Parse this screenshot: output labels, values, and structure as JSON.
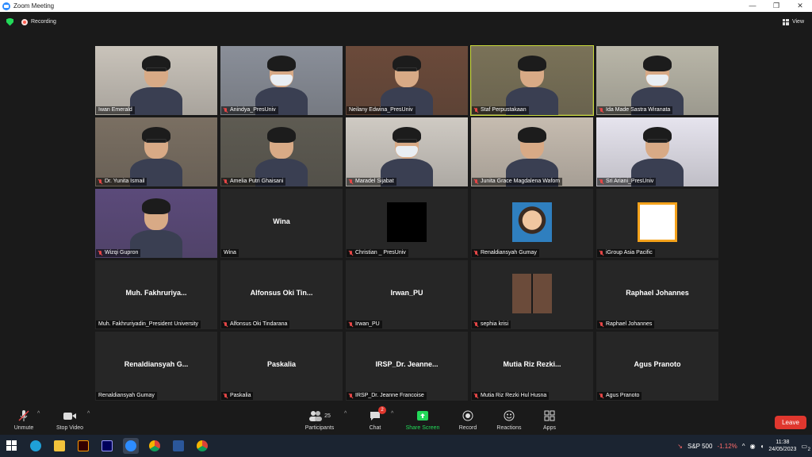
{
  "window": {
    "title": "Zoom Meeting",
    "controls": [
      "—",
      "❐",
      "✕"
    ]
  },
  "meeting_bar": {
    "recording_label": "Recording",
    "view_label": "View"
  },
  "participants": [
    {
      "name": "Iwan Emerald",
      "muted": false,
      "video": true,
      "bg": "#c9c3ba"
    },
    {
      "name": "Anindya_PresUniv",
      "muted": true,
      "video": true,
      "bg": "#8a8f99"
    },
    {
      "name": "Neilany Edwina_PresUniv",
      "muted": false,
      "video": true,
      "bg": "#6b4a3a"
    },
    {
      "name": "Staf Perpustakaan",
      "muted": true,
      "video": true,
      "bg": "#7a7258",
      "active": true
    },
    {
      "name": "Ida Made Sastra Wiranata",
      "muted": true,
      "video": true,
      "bg": "#b9b6a8"
    },
    {
      "name": "Dr. Yunita Ismail",
      "muted": true,
      "video": true,
      "bg": "#7a6f62"
    },
    {
      "name": "Amelia Putri Ghaisani",
      "muted": true,
      "video": true,
      "bg": "#5e5b52"
    },
    {
      "name": "Maradel Sijabat",
      "muted": true,
      "video": true,
      "bg": "#cfcac3"
    },
    {
      "name": "Junita Grace Magdalena Wafom",
      "muted": true,
      "video": true,
      "bg": "#c6bcb0"
    },
    {
      "name": "Sri Ariani_PresUniv",
      "muted": true,
      "video": true,
      "bg": "#e6e4ee"
    },
    {
      "name": "Wizqi Gupron",
      "muted": true,
      "video": true,
      "bg": "#5b4a7a"
    },
    {
      "name": "Wina",
      "muted": false,
      "video": false,
      "display": "Wina"
    },
    {
      "name": "Christian _ PresUniv",
      "muted": true,
      "video": false,
      "avatar": "black"
    },
    {
      "name": "Renaldiansyah Gumay",
      "muted": true,
      "video": false,
      "avatar": "cartoon"
    },
    {
      "name": "iGroup Asia Pacific",
      "muted": true,
      "video": false,
      "avatar": "logo"
    },
    {
      "name": "Muh. Fakhruriyadin_President University",
      "muted": false,
      "video": false,
      "display": "Muh.  Fakhruriya..."
    },
    {
      "name": "Alfonsus Oki Tindarana",
      "muted": true,
      "video": false,
      "display": "Alfonsus  Oki  Tin..."
    },
    {
      "name": "Irwan_PU",
      "muted": true,
      "video": false,
      "display": "Irwan_PU"
    },
    {
      "name": "sephia krisi",
      "muted": true,
      "video": false,
      "avatar": "photo"
    },
    {
      "name": "Raphael Johannes",
      "muted": true,
      "video": false,
      "display": "Raphael Johannes"
    },
    {
      "name": "Renaldiansyah Gumay",
      "muted": false,
      "video": false,
      "display": "Renaldiansyah  G..."
    },
    {
      "name": "Paskalia",
      "muted": true,
      "video": false,
      "display": "Paskalia"
    },
    {
      "name": "IRSP_Dr. Jeanne Francoise",
      "muted": true,
      "video": false,
      "display": "IRSP_Dr.  Jeanne..."
    },
    {
      "name": "Mutia Riz Rezki Hul Husna",
      "muted": true,
      "video": false,
      "display": "Mutia  Riz  Rezki..."
    },
    {
      "name": "Agus Pranoto",
      "muted": true,
      "video": false,
      "display": "Agus Pranoto"
    }
  ],
  "toolbar": {
    "unmute": "Unmute",
    "stop_video": "Stop Video",
    "participants": "Participants",
    "participants_count": "25",
    "chat": "Chat",
    "chat_badge": "2",
    "share_screen": "Share Screen",
    "record": "Record",
    "reactions": "Reactions",
    "apps": "Apps",
    "leave": "Leave"
  },
  "taskbar": {
    "stock_name": "S&P 500",
    "stock_change": "-1.12%",
    "time": "11:38",
    "date": "24/05/2023",
    "notifications": "2"
  },
  "colors": {
    "accent_green": "#23d959",
    "leave_red": "#e0372e",
    "active_speaker": "#c8d93a"
  }
}
